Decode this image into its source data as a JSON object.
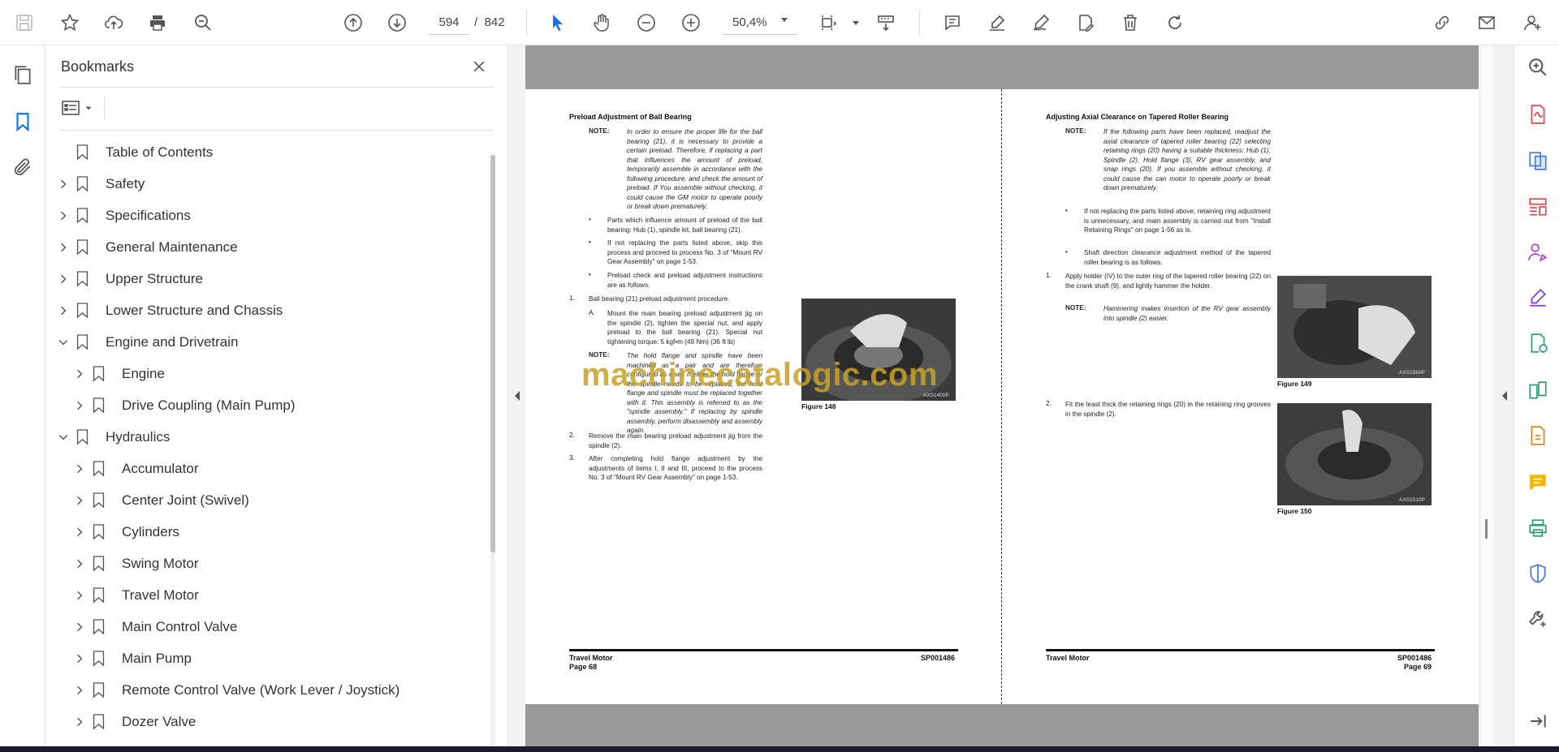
{
  "toolbar": {
    "current_page": "594",
    "page_separator": "/",
    "total_pages": "842",
    "zoom": "50,4%"
  },
  "bookmarks": {
    "title": "Bookmarks",
    "items": [
      {
        "label": "Table of Contents",
        "level": 0,
        "expandable": false,
        "expanded": false
      },
      {
        "label": "Safety",
        "level": 0,
        "expandable": true,
        "expanded": false
      },
      {
        "label": "Specifications",
        "level": 0,
        "expandable": true,
        "expanded": false
      },
      {
        "label": "General Maintenance",
        "level": 0,
        "expandable": true,
        "expanded": false
      },
      {
        "label": "Upper Structure",
        "level": 0,
        "expandable": true,
        "expanded": false
      },
      {
        "label": "Lower Structure and Chassis",
        "level": 0,
        "expandable": true,
        "expanded": false
      },
      {
        "label": "Engine and Drivetrain",
        "level": 0,
        "expandable": true,
        "expanded": true
      },
      {
        "label": "Engine",
        "level": 1,
        "expandable": true,
        "expanded": false
      },
      {
        "label": "Drive Coupling (Main Pump)",
        "level": 1,
        "expandable": true,
        "expanded": false
      },
      {
        "label": "Hydraulics",
        "level": 0,
        "expandable": true,
        "expanded": true
      },
      {
        "label": "Accumulator",
        "level": 1,
        "expandable": true,
        "expanded": false
      },
      {
        "label": "Center Joint (Swivel)",
        "level": 1,
        "expandable": true,
        "expanded": false
      },
      {
        "label": "Cylinders",
        "level": 1,
        "expandable": true,
        "expanded": false
      },
      {
        "label": "Swing Motor",
        "level": 1,
        "expandable": true,
        "expanded": false
      },
      {
        "label": "Travel Motor",
        "level": 1,
        "expandable": true,
        "expanded": false
      },
      {
        "label": "Main Control Valve",
        "level": 1,
        "expandable": true,
        "expanded": false
      },
      {
        "label": "Main Pump",
        "level": 1,
        "expandable": true,
        "expanded": false
      },
      {
        "label": "Remote Control Valve (Work Lever / Joystick)",
        "level": 1,
        "expandable": true,
        "expanded": false
      },
      {
        "label": "Dozer Valve",
        "level": 1,
        "expandable": true,
        "expanded": false
      }
    ]
  },
  "document": {
    "watermark": "machinecatalogic.com",
    "left_page": {
      "section_title": "Preload Adjustment of Ball Bearing",
      "note_label": "NOTE:",
      "note1": "In order to ensure the proper life for the ball bearing (21), it is necessary to provide a certain preload. Therefore, if replacing a part that influences the amount of preload, temporarily assemble in accordance with the following procedure, and check the amount of preload. If You assemble without checking, it could cause the GM motor to operate poorly or break down prematurely.",
      "bullet1": "Parts which influence amount of preload of the ball bearing: Hub (1), spindle kit, ball bearing (21).",
      "bullet2": "If not replacing the parts listed above, skip this process and proceed to process No. 3 of \"Mount RV Gear Assembly\" on page 1-53.",
      "bullet3": "Preload check and preload adjustment instructions are as follows.",
      "step1_num": "1.",
      "step1": "Ball bearing (21) preload adjustment procedure.",
      "stepA_num": "A.",
      "stepA": "Mount the main bearing preload adjustment jig on the spindle (2), tighten the special nut, and apply preload to the ball bearing (21). Special nut tightening torque: 5 kgf•m (49 Nm) (36 ft lb)",
      "note2": "The hold flange and spindle have been machined as a pair and are therefore configured as a set. If either the hold flange or the spindle needs to be replaced, the hold flange and spindle must be replaced together with it. This assembly is referred to as the \"spindle assembly.\" If replacing by spindle assembly, perform disassembly and assembly again.",
      "step2_num": "2.",
      "step2": "Remove the main bearing preload adjustment jig from the spindle (2).",
      "step3_num": "3.",
      "step3": "After completing hold flange adjustment by the adjustments of items I, II and III, proceed to the process No. 3 of \"Mount RV Gear Assembly\" on page 1-53.",
      "figure_caption": "Figure 148",
      "figure_code": "AXS1400P",
      "footer_section": "Travel Motor",
      "footer_page": "Page 68",
      "footer_code": "SP001486"
    },
    "right_page": {
      "section_title": "Adjusting Axial Clearance on Tapered Roller Bearing",
      "note_label": "NOTE:",
      "note1": "If the following parts have been replaced, readjust the axial clearance of tapered roller bearing (22) selecting retaining rings (20) having a suitable thickness: Hub (1), Spindle (2), Hold flange (3), RV gear assembly, and snap rings (20). If you assemble without checking, it could cause the can motor to operate poorly or break down prematurely.",
      "bullet1": "If not replacing the parts listed above, retaining ring adjustment is unnecessary, and main assembly is carried out from \"Install Retaining Rings\" on page 1-56 as is.",
      "bullet2": "Shaft direction clearance adjustment method of the tapered roller bearing is as follows.",
      "step1_num": "1.",
      "step1": "Apply holder (IV) to the outer ring of the tapered roller bearing (22) on the crank shaft (9), and lightly hammer the holder.",
      "note2": "Hammering makes insertion of the RV gear assembly into spindle (2) easier.",
      "step2_num": "2.",
      "step2": "Fit the least thick the retaining rings (20) in the retaining ring grooves in the spindle (2).",
      "figure1_caption": "Figure 149",
      "figure1_code": "AXS1560P",
      "figure2_caption": "Figure 150",
      "figure2_code": "AXS1510P",
      "footer_section": "Travel Motor",
      "footer_page": "Page 69",
      "footer_code": "SP001486"
    }
  },
  "colors": {
    "accent_blue": "#1473e6",
    "rail_purple": "#7b3fe4",
    "rail_red": "#e34850",
    "rail_green": "#2d9d78",
    "rail_orange": "#e68619",
    "watermark": "#c9a227"
  }
}
